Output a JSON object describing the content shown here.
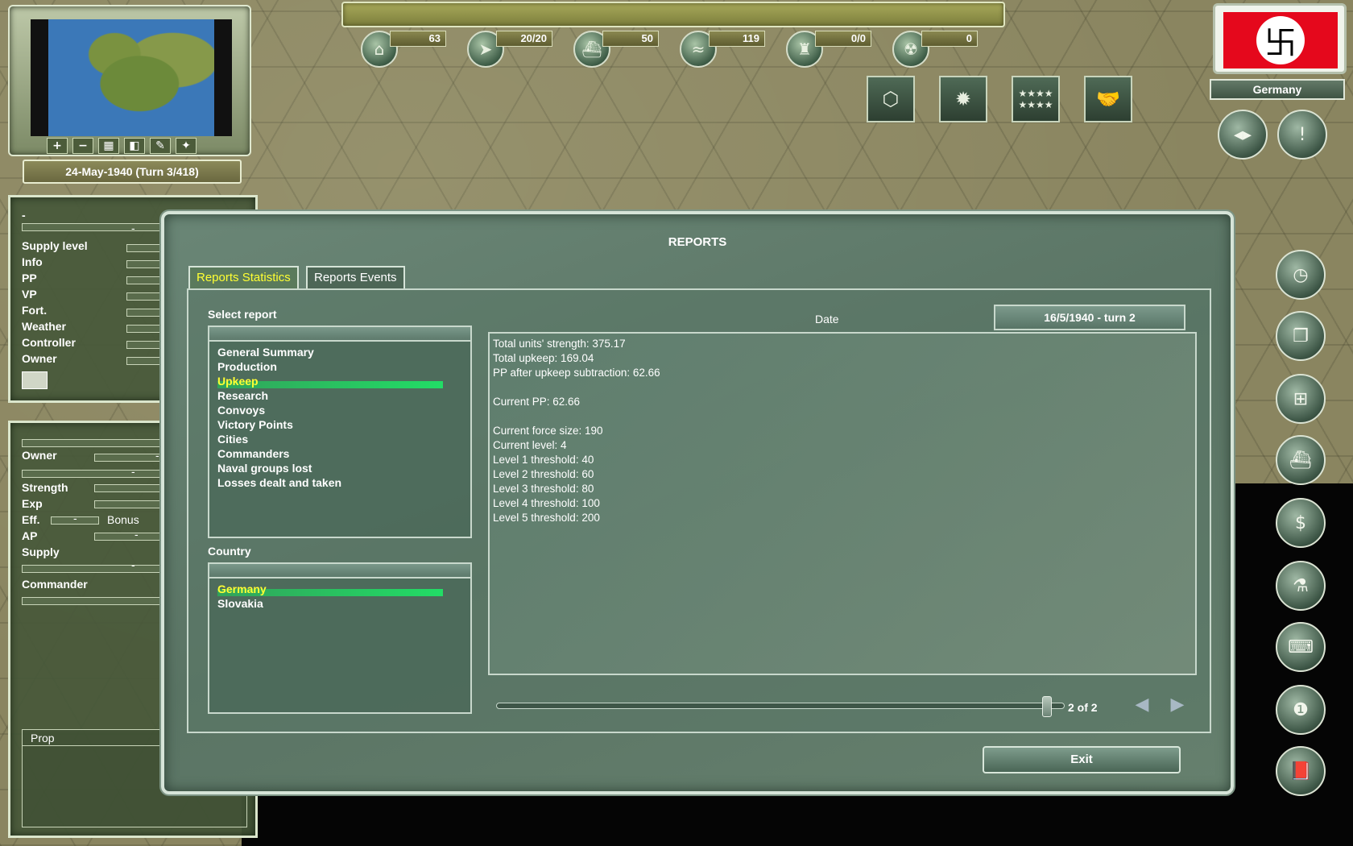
{
  "minimap": {
    "toolbar": [
      "+",
      "−",
      "▦",
      "◧",
      "✎",
      "✦"
    ]
  },
  "date": "24-May-1940 (Turn 3/418)",
  "resources": [
    {
      "icon": "industry-icon",
      "glyph": "⌂",
      "value": "63"
    },
    {
      "icon": "air-icon",
      "glyph": "➤",
      "value": "20/20"
    },
    {
      "icon": "naval-icon",
      "glyph": "⛴",
      "value": "50"
    },
    {
      "icon": "diplomacy-icon",
      "glyph": "≈",
      "value": "119"
    },
    {
      "icon": "rocket-icon",
      "glyph": "♜",
      "value": "0/0"
    },
    {
      "icon": "nuclear-icon",
      "glyph": "☢",
      "value": "0"
    }
  ],
  "filters": [
    {
      "icon": "hex-grid-icon",
      "glyph": "⬡"
    },
    {
      "icon": "weather-icon",
      "glyph": "✹"
    },
    {
      "icon": "ranks-icon",
      "glyph": "★★★★ ★★★★"
    },
    {
      "icon": "handshake-icon",
      "glyph": "🤝"
    }
  ],
  "country": {
    "name": "Germany",
    "flag_color": "#e5081c"
  },
  "info_panel": {
    "top_value": "-",
    "dash": "-",
    "rows": [
      "Supply level",
      "Info",
      "PP",
      "VP",
      "Fort.",
      "Weather",
      "Controller",
      "Owner"
    ]
  },
  "unit_panel": {
    "owner_label": "Owner",
    "dash": "-",
    "strength_label": "Strength",
    "exp_label": "Exp",
    "eff_label": "Eff.",
    "bonus_label": "Bonus",
    "ap_label": "AP",
    "supply_label": "Supply",
    "commander_label": "Commander",
    "prop_header": "Prop"
  },
  "reports": {
    "title": "REPORTS",
    "tabs": [
      {
        "label": "Reports Statistics",
        "active": true
      },
      {
        "label": "Reports Events",
        "active": false
      }
    ],
    "select_report_label": "Select report",
    "reports_list": [
      "General Summary",
      "Production",
      "Upkeep",
      "Research",
      "Convoys",
      "Victory Points",
      "Cities",
      "Commanders",
      "Naval groups lost",
      "Losses dealt and taken"
    ],
    "selected_report": "Upkeep",
    "country_label": "Country",
    "countries": [
      "Germany",
      "Slovakia"
    ],
    "selected_country": "Germany",
    "date_label": "Date",
    "date_value": "16/5/1940 - turn 2",
    "report_lines": [
      "Total units' strength: 375.17",
      "Total upkeep: 169.04",
      "PP after upkeep subtraction: 62.66",
      "",
      "Current PP: 62.66",
      "",
      "Current force size: 190",
      "Current level: 4",
      "Level 1 threshold: 40",
      "Level 2 threshold: 60",
      "Level 3 threshold: 80",
      "Level 4 threshold: 100",
      "Level 5 threshold: 200"
    ],
    "page_label": "2 of 2",
    "page_position": 1.0,
    "exit_label": "Exit"
  },
  "side_buttons": [
    {
      "icon": "clock-icon",
      "glyph": "◷"
    },
    {
      "icon": "windows-icon",
      "glyph": "❐"
    },
    {
      "icon": "hierarchy-icon",
      "glyph": "⊞"
    },
    {
      "icon": "fleet-icon",
      "glyph": "⛴"
    },
    {
      "icon": "trade-icon",
      "glyph": "$"
    },
    {
      "icon": "research-icon",
      "glyph": "⚗"
    },
    {
      "icon": "typewriter-icon",
      "glyph": "⌨"
    },
    {
      "icon": "intelligence-icon",
      "glyph": "❶"
    },
    {
      "icon": "book-icon",
      "glyph": "📕"
    }
  ]
}
